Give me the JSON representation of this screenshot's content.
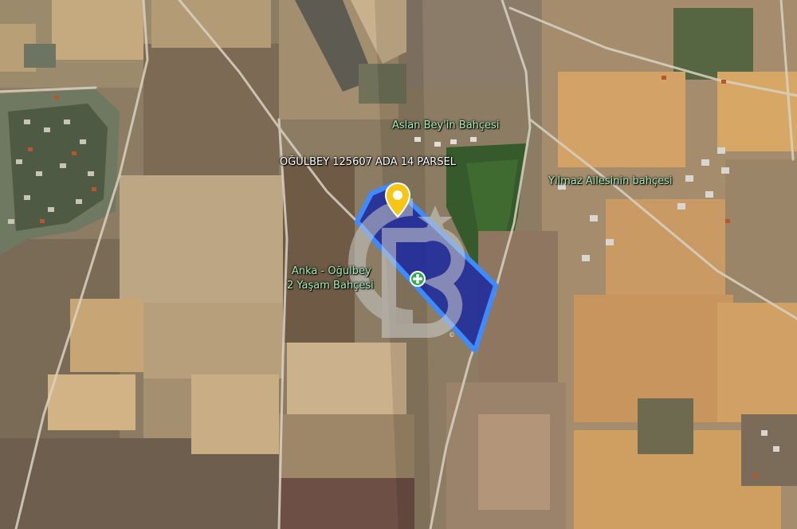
{
  "map": {
    "type": "satellite",
    "colors": {
      "parcel_fill": "#1e2a9e",
      "parcel_border": "#3d8bff",
      "pin": "#f7c614",
      "label_white": "#ffffff",
      "label_green": "#a9f0b9",
      "poi_green": "#34a853"
    }
  },
  "labels": {
    "parcel": "OĞULBEY 125607 ADA 14 PARSEL",
    "aslan": "Aslan Bey'in Bahçesi",
    "yilmaz": "Yılmaz Ailesinin bahçesi",
    "anka_line1": "Anka - Oğulbey",
    "anka_line2": "2 Yaşam Bahçesi"
  },
  "icons": {
    "location_pin": "location-pin-icon",
    "garden_poi": "garden-poi-icon",
    "watermark": "cb-logo-watermark"
  },
  "watermark": {
    "copyright": "©"
  }
}
